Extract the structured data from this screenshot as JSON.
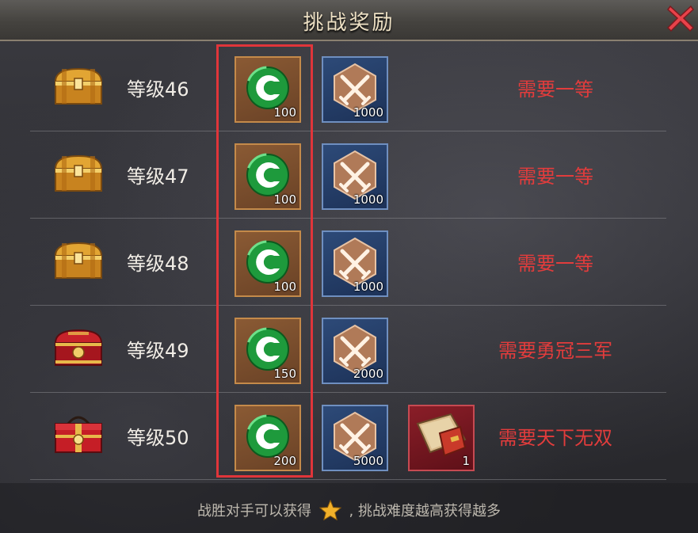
{
  "window": {
    "title": "挑战奖励"
  },
  "rows": [
    {
      "level": "等级46",
      "chest": "gold-chest",
      "jade_qty": "100",
      "merit_qty": "1000",
      "requirement": "需要一等"
    },
    {
      "level": "等级47",
      "chest": "gold-chest",
      "jade_qty": "100",
      "merit_qty": "1000",
      "requirement": "需要一等"
    },
    {
      "level": "等级48",
      "chest": "gold-chest",
      "jade_qty": "100",
      "merit_qty": "1000",
      "requirement": "需要一等"
    },
    {
      "level": "等级49",
      "chest": "red-chest",
      "jade_qty": "150",
      "merit_qty": "2000",
      "requirement": "需要勇冠三军"
    },
    {
      "level": "等级50",
      "chest": "red-gift-box",
      "jade_qty": "200",
      "merit_qty": "5000",
      "book_qty": "1",
      "requirement": "需要天下无双"
    }
  ],
  "footer": {
    "before": "战胜对手可以获得",
    "after": ", 挑战难度越高获得越多",
    "icon": "star-icon"
  },
  "colors": {
    "requirement": "#e23c3c",
    "highlight": "#e0353a"
  }
}
